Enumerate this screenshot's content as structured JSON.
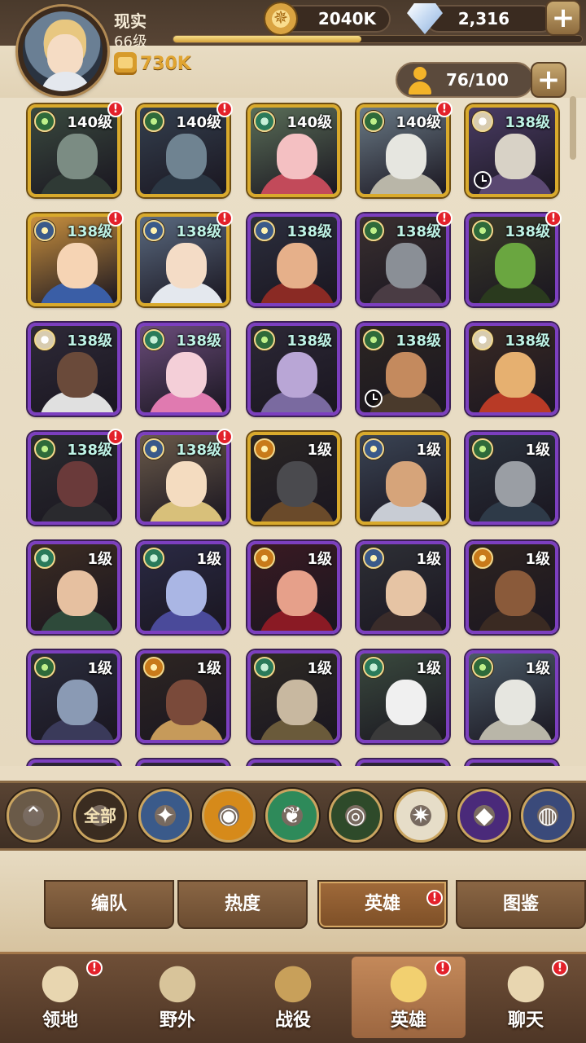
{
  "player": {
    "name": "现实",
    "level": "66级",
    "power": "730K",
    "xp_progress": 0.46
  },
  "resources": {
    "gold": "2040K",
    "gems": "2,316",
    "plus": "+"
  },
  "roster": {
    "count": "76/100",
    "plus": "+"
  },
  "colors": {
    "frame_gold": "#d9aa2c",
    "frame_purple": "#7c3fbf",
    "badge_red": "#e3212a",
    "bg_parchment": "#e9dcc3"
  },
  "heroes": [
    {
      "level": "140级",
      "frame": "gold",
      "faction": "wilder",
      "badge": true,
      "clock": false,
      "skin": "#7b8c83",
      "cloth": "#2f3a35",
      "bg": "#3a4a3f"
    },
    {
      "level": "140级",
      "frame": "gold",
      "faction": "wilder",
      "badge": true,
      "clock": false,
      "skin": "#6f8391",
      "cloth": "#2b3744",
      "bg": "#34404f"
    },
    {
      "level": "140级",
      "frame": "gold",
      "faction": "graveborn",
      "badge": false,
      "clock": false,
      "skin": "#f4c0c2",
      "cloth": "#c24a5a",
      "bg": "#5a6e58"
    },
    {
      "level": "140级",
      "frame": "gold",
      "faction": "wilder",
      "badge": true,
      "clock": false,
      "skin": "#e6e6e0",
      "cloth": "#b9b6a8",
      "bg": "#6a7a86"
    },
    {
      "level": "138级",
      "frame": "gold",
      "faction": "celestial",
      "badge": false,
      "clock": true,
      "skin": "#d8d2c6",
      "cloth": "#5b4872",
      "bg": "#4a3c64"
    },
    {
      "level": "138级",
      "frame": "gold",
      "faction": "lightbearer",
      "badge": true,
      "clock": false,
      "skin": "#f6d4b4",
      "cloth": "#3a5ea6",
      "bg": "#c9903e"
    },
    {
      "level": "138级",
      "frame": "gold",
      "faction": "lightbearer",
      "badge": true,
      "clock": false,
      "skin": "#f4dcc6",
      "cloth": "#e4e8ee",
      "bg": "#5a6a80"
    },
    {
      "level": "138级",
      "frame": "purple",
      "faction": "lightbearer",
      "badge": false,
      "clock": false,
      "skin": "#e6b08a",
      "cloth": "#8a2a24",
      "bg": "#2c2f3e"
    },
    {
      "level": "138级",
      "frame": "purple",
      "faction": "wilder",
      "badge": true,
      "clock": false,
      "skin": "#8a8f96",
      "cloth": "#4a3c44",
      "bg": "#3a3030"
    },
    {
      "level": "138级",
      "frame": "purple",
      "faction": "wilder",
      "badge": true,
      "clock": false,
      "skin": "#6aa640",
      "cloth": "#2a3a1e",
      "bg": "#3a3a2a"
    },
    {
      "level": "138级",
      "frame": "purple",
      "faction": "celestial",
      "badge": false,
      "clock": false,
      "skin": "#6a4a3a",
      "cloth": "#e0e0e0",
      "bg": "#2e2a38"
    },
    {
      "level": "138级",
      "frame": "purple",
      "faction": "graveborn",
      "badge": false,
      "clock": false,
      "skin": "#f4cfd8",
      "cloth": "#e07ab0",
      "bg": "#6a4c7a"
    },
    {
      "level": "138级",
      "frame": "purple",
      "faction": "wilder",
      "badge": false,
      "clock": false,
      "skin": "#b9a6d6",
      "cloth": "#7a6aa0",
      "bg": "#2c2836"
    },
    {
      "level": "138级",
      "frame": "purple",
      "faction": "wilder",
      "badge": false,
      "clock": true,
      "skin": "#c48a5e",
      "cloth": "#4a3a2c",
      "bg": "#2c2622"
    },
    {
      "level": "138级",
      "frame": "purple",
      "faction": "celestial",
      "badge": false,
      "clock": false,
      "skin": "#e6b070",
      "cloth": "#b83a26",
      "bg": "#3a2a24"
    },
    {
      "level": "138级",
      "frame": "purple",
      "faction": "wilder",
      "badge": true,
      "clock": false,
      "skin": "#6a3a3a",
      "cloth": "#2a2a2e",
      "bg": "#2a2c30"
    },
    {
      "level": "138级",
      "frame": "purple",
      "faction": "lightbearer",
      "badge": true,
      "clock": false,
      "skin": "#f4dcc0",
      "cloth": "#d8c07a",
      "bg": "#6a5a4a"
    },
    {
      "level": "1级",
      "frame": "gold",
      "faction": "mauler",
      "badge": false,
      "clock": false,
      "skin": "#4a4a4e",
      "cloth": "#6a4a2a",
      "bg": "#2a2624"
    },
    {
      "level": "1级",
      "frame": "gold",
      "faction": "lightbearer",
      "badge": false,
      "clock": false,
      "skin": "#d6a47a",
      "cloth": "#c8ccd4",
      "bg": "#3a4454"
    },
    {
      "level": "1级",
      "frame": "purple",
      "faction": "wilder",
      "badge": false,
      "clock": false,
      "skin": "#9a9ea4",
      "cloth": "#2e3a48",
      "bg": "#2a323c"
    },
    {
      "level": "1级",
      "frame": "purple",
      "faction": "graveborn",
      "badge": false,
      "clock": false,
      "skin": "#e6c0a0",
      "cloth": "#2e4a3a",
      "bg": "#3c2c22"
    },
    {
      "level": "1级",
      "frame": "purple",
      "faction": "graveborn",
      "badge": false,
      "clock": false,
      "skin": "#aab6e4",
      "cloth": "#4a4a9a",
      "bg": "#2a2a44"
    },
    {
      "level": "1级",
      "frame": "purple",
      "faction": "mauler",
      "badge": false,
      "clock": false,
      "skin": "#e6a08a",
      "cloth": "#8a1a24",
      "bg": "#3a1a22"
    },
    {
      "level": "1级",
      "frame": "purple",
      "faction": "lightbearer",
      "badge": false,
      "clock": false,
      "skin": "#e6c4a4",
      "cloth": "#3a2c2a",
      "bg": "#2e3036"
    },
    {
      "level": "1级",
      "frame": "purple",
      "faction": "mauler",
      "badge": false,
      "clock": false,
      "skin": "#8a5a3a",
      "cloth": "#3a2a22",
      "bg": "#2e2420"
    },
    {
      "level": "1级",
      "frame": "purple",
      "faction": "wilder",
      "badge": false,
      "clock": false,
      "skin": "#8a9ab4",
      "cloth": "#3a3a5a",
      "bg": "#2a2c3c"
    },
    {
      "level": "1级",
      "frame": "purple",
      "faction": "mauler",
      "badge": false,
      "clock": false,
      "skin": "#7a4a3a",
      "cloth": "#c69a5a",
      "bg": "#2e2622"
    },
    {
      "level": "1级",
      "frame": "purple",
      "faction": "graveborn",
      "badge": false,
      "clock": false,
      "skin": "#c8b8a0",
      "cloth": "#6a5a3a",
      "bg": "#2e2a24"
    },
    {
      "level": "1级",
      "frame": "purple",
      "faction": "graveborn",
      "badge": false,
      "clock": false,
      "skin": "#f0f0f0",
      "cloth": "#3a3a3a",
      "bg": "#3a4a3e"
    },
    {
      "level": "1级",
      "frame": "purple",
      "faction": "wilder",
      "badge": false,
      "clock": false,
      "skin": "#e6e6e0",
      "cloth": "#b9b6a8",
      "bg": "#4a5a66"
    }
  ],
  "filters": [
    {
      "name": "collapse",
      "label": "",
      "icon": "double-chevron-up-icon",
      "bg": "#6a5a48",
      "glyph": "⌃"
    },
    {
      "name": "all",
      "label": "全部",
      "icon": "",
      "bg": "#3a2c20",
      "glyph": ""
    },
    {
      "name": "lightbearer",
      "label": "",
      "icon": "lightbearer-star-icon",
      "bg": "#3a5a8a",
      "glyph": "✦"
    },
    {
      "name": "mauler",
      "label": "",
      "icon": "mauler-emblem-icon",
      "bg": "#d68a1a",
      "glyph": "◉"
    },
    {
      "name": "wilder",
      "label": "",
      "icon": "wilder-leaf-icon",
      "bg": "#2e8a5a",
      "glyph": "❦"
    },
    {
      "name": "graveborn",
      "label": "",
      "icon": "graveborn-eye-icon",
      "bg": "#2e4a2a",
      "glyph": "◎"
    },
    {
      "name": "celestial",
      "label": "",
      "icon": "celestial-sun-icon",
      "bg": "#e6ddc8",
      "glyph": "✷"
    },
    {
      "name": "hypogean",
      "label": "",
      "icon": "hypogean-crystal-icon",
      "bg": "#4a2a7a",
      "glyph": "◆"
    },
    {
      "name": "dimensional",
      "label": "",
      "icon": "dimensional-orb-icon",
      "bg": "#3a4a7a",
      "glyph": "◍"
    }
  ],
  "subtabs": [
    {
      "label": "编队",
      "active": false,
      "badge": false
    },
    {
      "label": "热度",
      "active": false,
      "badge": false
    },
    {
      "label": "英雄",
      "active": true,
      "badge": true
    },
    {
      "label": "图鉴",
      "active": false,
      "badge": false
    }
  ],
  "nav": [
    {
      "label": "领地",
      "icon": "castle-icon",
      "badge": true,
      "active": false,
      "color": "#e8d6b0"
    },
    {
      "label": "野外",
      "icon": "scroll-map-icon",
      "badge": false,
      "active": false,
      "color": "#d8c49a"
    },
    {
      "label": "战役",
      "icon": "crossed-swords-icon",
      "badge": false,
      "active": false,
      "color": "#c8a05a"
    },
    {
      "label": "英雄",
      "icon": "helmet-icon",
      "badge": true,
      "active": true,
      "color": "#f2d070"
    },
    {
      "label": "聊天",
      "icon": "chat-bubble-icon",
      "badge": true,
      "active": false,
      "color": "#e8d6b0"
    }
  ]
}
